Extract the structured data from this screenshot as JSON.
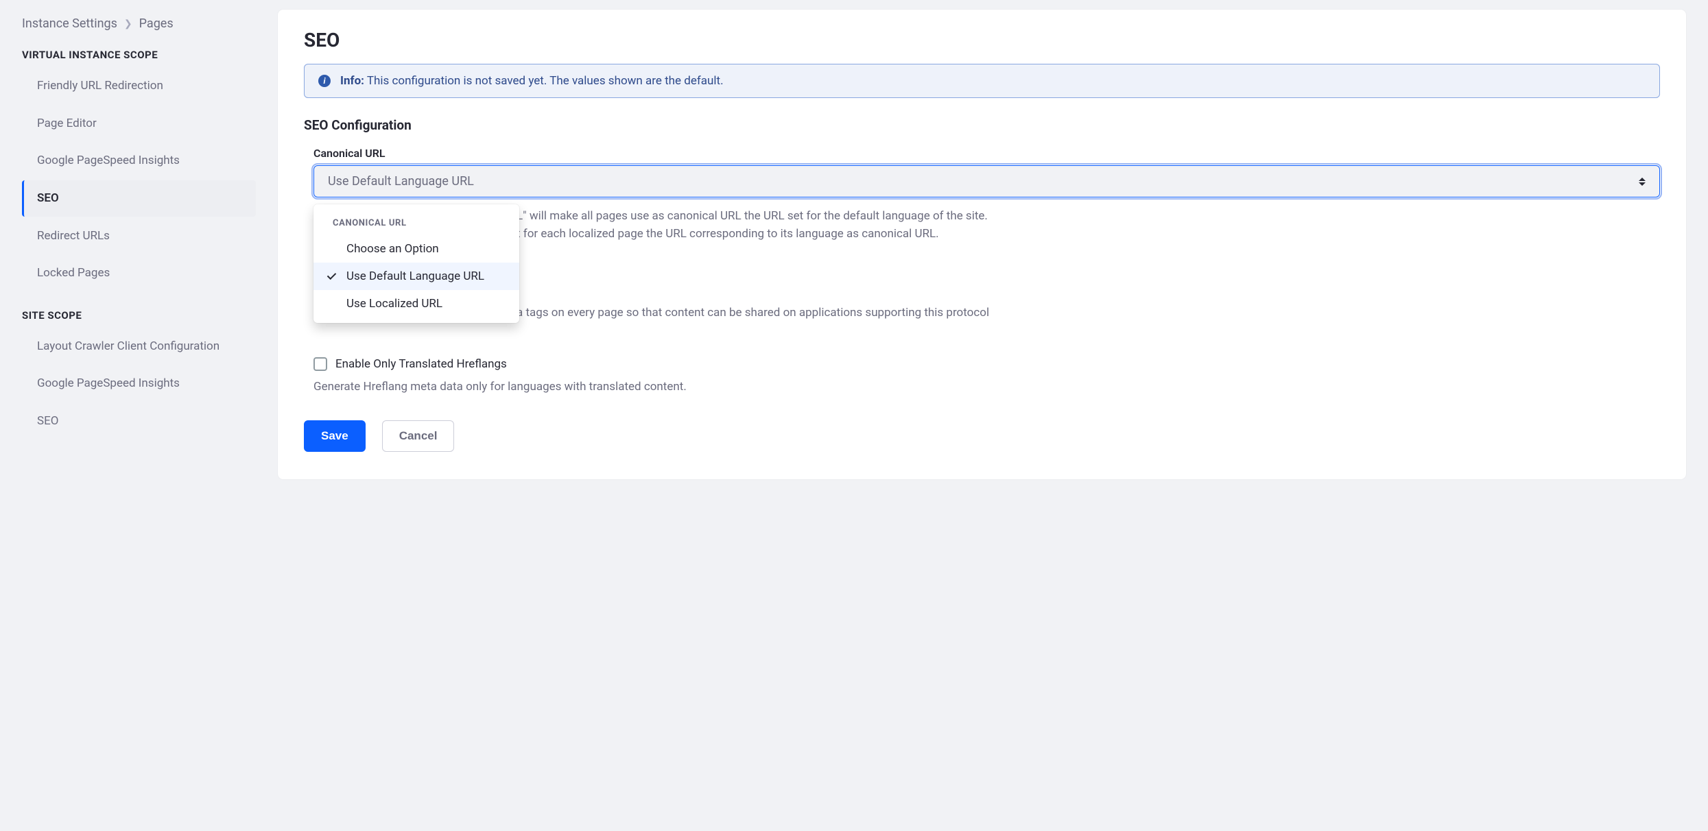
{
  "breadcrumb": {
    "root": "Instance Settings",
    "current": "Pages"
  },
  "sidebar": {
    "section1_title": "VIRTUAL INSTANCE SCOPE",
    "section1_items": [
      {
        "label": "Friendly URL Redirection"
      },
      {
        "label": "Page Editor"
      },
      {
        "label": "Google PageSpeed Insights"
      },
      {
        "label": "SEO",
        "active": true
      },
      {
        "label": "Redirect URLs"
      },
      {
        "label": "Locked Pages"
      }
    ],
    "section2_title": "SITE SCOPE",
    "section2_items": [
      {
        "label": "Layout Crawler Client Configuration"
      },
      {
        "label": "Google PageSpeed Insights"
      },
      {
        "label": "SEO"
      }
    ]
  },
  "page": {
    "title": "SEO",
    "alert_label": "Info:",
    "alert_text": "This configuration is not saved yet. The values shown are the default.",
    "subheading": "SEO Configuration",
    "canonical": {
      "label": "Canonical URL",
      "value": "Use Default Language URL",
      "dropdown_header": "CANONICAL URL",
      "options": [
        {
          "label": "Choose an Option",
          "selected": false
        },
        {
          "label": "Use Default Language URL",
          "selected": true
        },
        {
          "label": "Use Localized URL",
          "selected": false
        }
      ],
      "help_fragment_a": "L\" will make all pages use as canonical URL the URL set for the default language of the site.",
      "help_fragment_b": "t for each localized page the URL corresponding to its language as canonical URL."
    },
    "opengraph_help": "a tags on every page so that content can be shared on applications supporting this protocol",
    "hreflang": {
      "label": "Enable Only Translated Hreflangs",
      "help": "Generate Hreflang meta data only for languages with translated content."
    },
    "buttons": {
      "save": "Save",
      "cancel": "Cancel"
    }
  }
}
